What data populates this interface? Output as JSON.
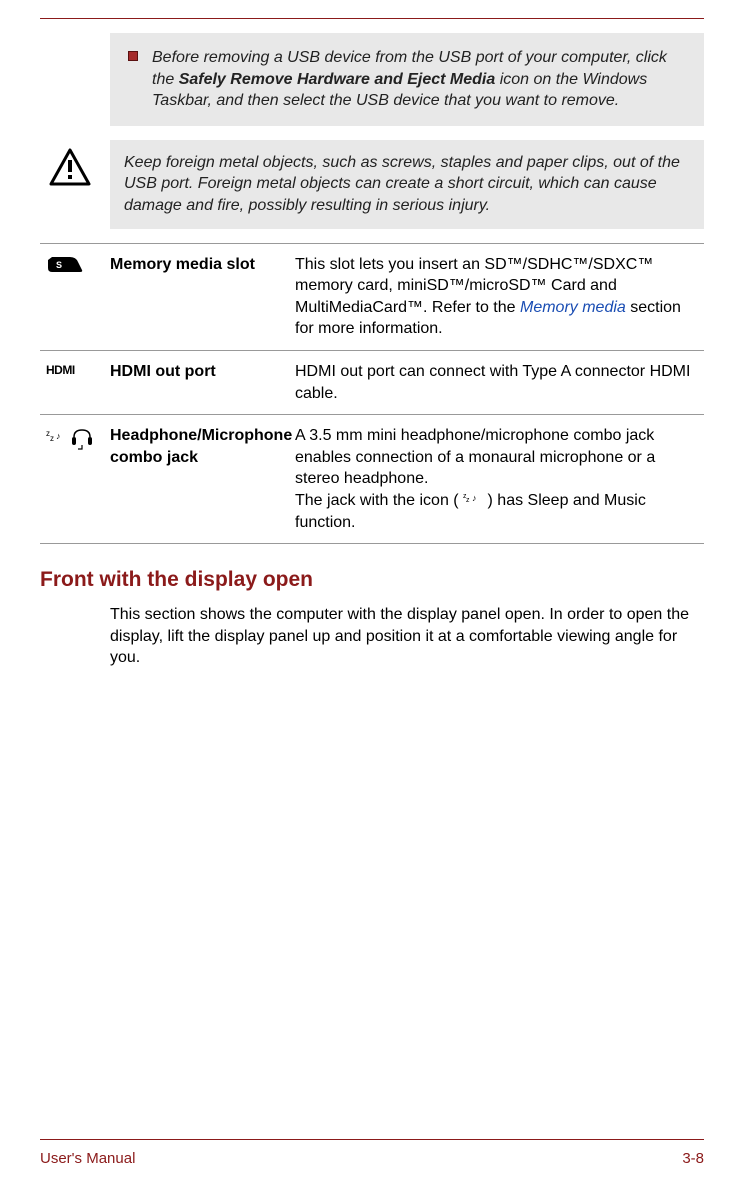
{
  "note": {
    "pre": "Before removing a USB device from the USB port of your computer, click the ",
    "bold": "Safely Remove Hardware and Eject Media",
    "post": " icon on the Windows Taskbar, and then select the USB device that you want to remove."
  },
  "warning": "Keep foreign metal objects, such as screws, staples and paper clips, out of the USB port. Foreign metal objects can create a short circuit, which can cause damage and fire, possibly resulting in serious injury.",
  "specs": [
    {
      "label": "Memory media slot",
      "desc_pre": "This slot lets you insert an SD™/SDHC™/SDXC™ memory card, miniSD™/microSD™ Card and MultiMediaCard™. Refer to the ",
      "link": "Memory media",
      "desc_post": " section for more information."
    },
    {
      "label": "HDMI out port",
      "desc": "HDMI out port can connect with Type A connector HDMI cable."
    },
    {
      "label": "Headphone/Microphone combo jack",
      "desc_line1": "A 3.5 mm mini headphone/microphone combo jack enables connection of a monaural microphone or a stereo headphone.",
      "desc_line2_pre": "The jack with the icon ( ",
      "desc_line2_post": " ) has Sleep and Music function."
    }
  ],
  "heading": "Front with the display open",
  "paragraph": "This section shows the computer with the display panel open. In order to open the display, lift the display panel up and position it at a comfortable viewing angle for you.",
  "footer": {
    "left": "User's Manual",
    "right": "3-8"
  }
}
